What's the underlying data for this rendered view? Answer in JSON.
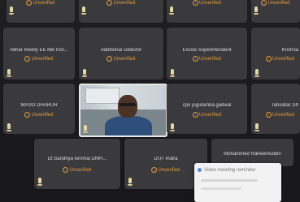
{
  "participants": [
    {
      "id": "top-1",
      "name": "",
      "status": "Unverified"
    },
    {
      "id": "top-2",
      "name": "",
      "status": "Unverified"
    },
    {
      "id": "top-3",
      "name": "",
      "status": "Unverified"
    },
    {
      "id": "top-4",
      "name": "",
      "status": "Unverified"
    },
    {
      "id": "top-5",
      "name": "",
      "status": "Unverified"
    },
    {
      "id": "row2-1",
      "name": "ndhar Reddy EE MB Inst...",
      "status": "Unverified"
    },
    {
      "id": "row2-2",
      "name": "Additional collector",
      "status": "Unverified"
    },
    {
      "id": "row2-3",
      "name": "Excise Superintendent",
      "status": "Unverified"
    },
    {
      "id": "row2-4",
      "name": "Krishna",
      "status": "Unverified"
    },
    {
      "id": "row3-1",
      "name": "MPDO DHARUR",
      "status": "Unverified"
    },
    {
      "id": "row3-3",
      "name": "cpo jogulamba gadwal",
      "status": "Unverified"
    },
    {
      "id": "row3-4",
      "name": "Tahsildar Dh",
      "status": "Unverified"
    },
    {
      "id": "row4-1",
      "name": "Dr.Sandhya kirnmai DMH...",
      "status": "Unverified"
    },
    {
      "id": "row4-2",
      "name": "Dr.P. Indira",
      "status": "Unverified"
    },
    {
      "id": "row4-3",
      "name": "Mohammed Raheemuddin",
      "status": ""
    }
  ],
  "popup": {
    "title": "Video meeting reminder"
  },
  "colors": {
    "tile": "#3a3a3d",
    "status": "#e39a3a",
    "background": "#1c1c1e"
  }
}
